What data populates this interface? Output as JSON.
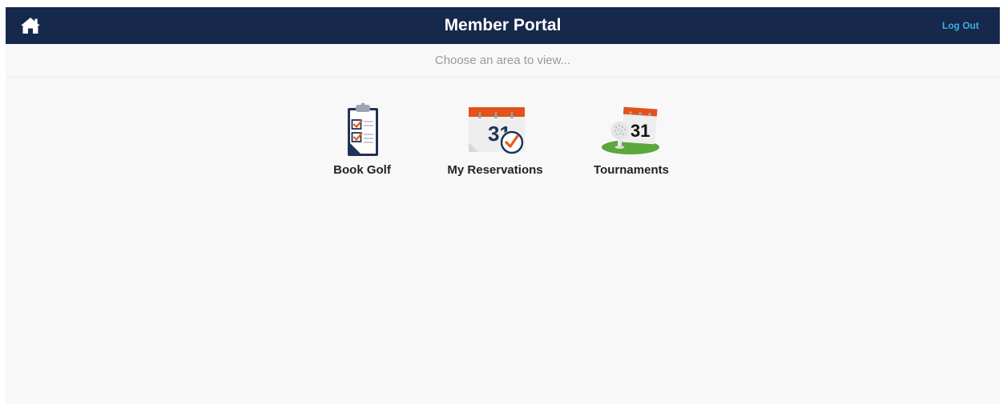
{
  "header": {
    "title": "Member Portal",
    "home_icon": "home-icon",
    "logout_label": "Log Out"
  },
  "subheader": {
    "prompt": "Choose an area to view..."
  },
  "tiles": [
    {
      "label": "Book Golf",
      "icon": "clipboard-checklist-icon"
    },
    {
      "label": "My Reservations",
      "icon": "calendar-check-icon"
    },
    {
      "label": "Tournaments",
      "icon": "calendar-golf-ball-icon"
    }
  ],
  "colors": {
    "navbar": "#16284b",
    "logout_link": "#3ab0e6",
    "calendar_header": "#e2531c",
    "check_orange": "#e85a17",
    "grass_green": "#5aa83a"
  },
  "calendar_day": "31"
}
